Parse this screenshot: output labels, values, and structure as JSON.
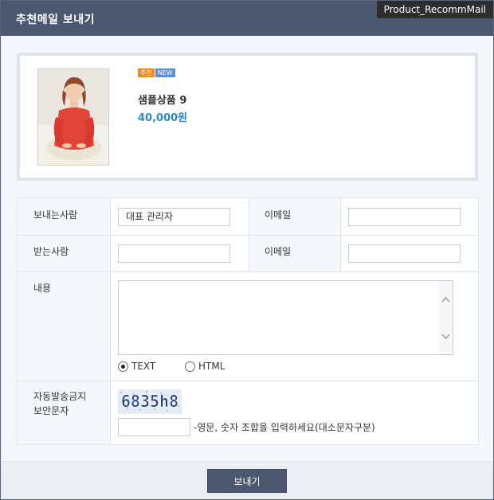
{
  "window": {
    "title": "추천메일 보내기",
    "tag": "Product_RecommMail"
  },
  "product": {
    "badge_recommend": "추천",
    "badge_new": "NEW",
    "name": "샘플상품 9",
    "price": "40,000원"
  },
  "form": {
    "sender_label": "보내는사람",
    "sender_value": "대표 관리자",
    "sender_email_label": "이메일",
    "sender_email_value": "",
    "receiver_label": "받는사람",
    "receiver_value": "",
    "receiver_email_label": "이메일",
    "receiver_email_value": "",
    "content_label": "내용",
    "content_value": "",
    "format_options": [
      "TEXT",
      "HTML"
    ],
    "format_selected": "TEXT",
    "captcha_label_line1": "자동발송금지",
    "captcha_label_line2": "보안문자",
    "captcha_image_text": "6835h8",
    "captcha_input_value": "",
    "captcha_help": "-영문, 숫자 조합을 입력하세요(대소문자구분)"
  },
  "footer": {
    "send_label": "보내기"
  },
  "colors": {
    "header": "#4c5870",
    "price": "#2a8ac0",
    "badge_recommend": "#f08a1c",
    "badge_new": "#5c8ed6"
  }
}
